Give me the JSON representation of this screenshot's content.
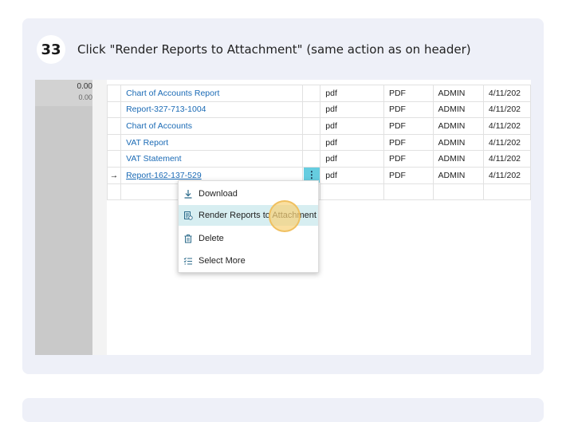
{
  "step": {
    "number": "33",
    "instruction": "Click \"Render Reports to Attachment\" (same action as on header)"
  },
  "left_pane": {
    "value_top": "0.00",
    "value_sub": "0.00"
  },
  "grid": {
    "rows": [
      {
        "name": "Chart of Accounts Report",
        "ext": "pdf",
        "format": "PDF",
        "user": "ADMIN",
        "date": "4/11/202"
      },
      {
        "name": "Report-327-713-1004",
        "ext": "pdf",
        "format": "PDF",
        "user": "ADMIN",
        "date": "4/11/202"
      },
      {
        "name": "Chart of Accounts",
        "ext": "pdf",
        "format": "PDF",
        "user": "ADMIN",
        "date": "4/11/202"
      },
      {
        "name": "VAT Report",
        "ext": "pdf",
        "format": "PDF",
        "user": "ADMIN",
        "date": "4/11/202"
      },
      {
        "name": "VAT Statement",
        "ext": "pdf",
        "format": "PDF",
        "user": "ADMIN",
        "date": "4/11/202"
      },
      {
        "name": "Report-162-137-529",
        "ext": "pdf",
        "format": "PDF",
        "user": "ADMIN",
        "date": "4/11/202",
        "current": true
      }
    ],
    "current_arrow": "→",
    "dots": "⋮"
  },
  "context_menu": {
    "items": [
      {
        "label": "Download",
        "icon": "download-icon"
      },
      {
        "label": "Render Reports to Attachment",
        "icon": "render-report-icon",
        "highlighted": true
      },
      {
        "label": "Delete",
        "icon": "trash-icon"
      },
      {
        "label": "Select More",
        "icon": "select-list-icon"
      }
    ]
  },
  "colors": {
    "accent": "#66cde0",
    "link": "#1a6ab5",
    "highlight": "#d7eef1",
    "click_marker": "#f8d278"
  }
}
